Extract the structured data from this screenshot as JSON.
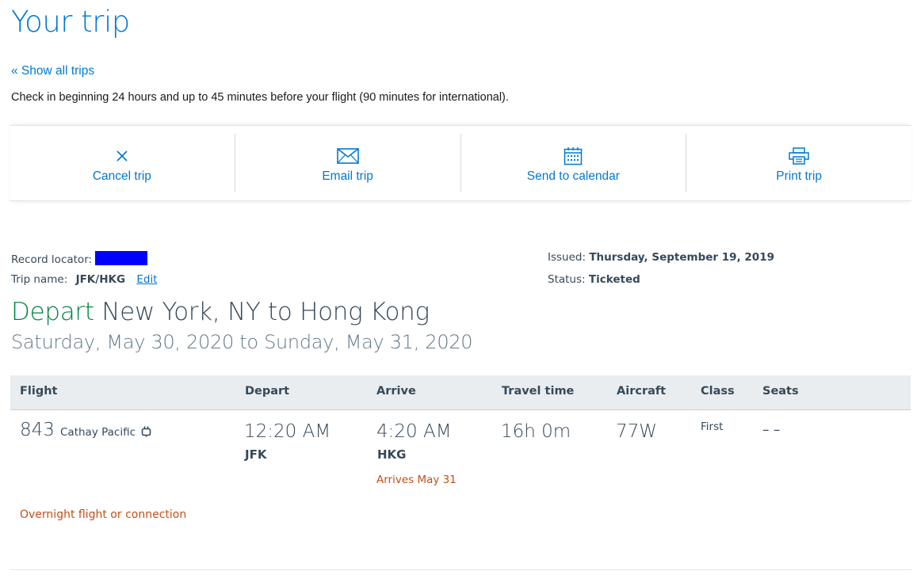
{
  "header": {
    "title": "Your trip",
    "show_all_trips": "« Show all trips",
    "checkin_note": "Check in beginning 24 hours and up to 45 minutes before your flight (90 minutes for international)."
  },
  "actions": [
    {
      "label": "Cancel trip",
      "icon": "close-icon"
    },
    {
      "label": "Email trip",
      "icon": "envelope-icon"
    },
    {
      "label": "Send to calendar",
      "icon": "calendar-icon"
    },
    {
      "label": "Print trip",
      "icon": "printer-icon"
    }
  ],
  "record": {
    "locator_label": "Record locator:",
    "trip_name_label": "Trip name:",
    "trip_name": "JFK/HKG",
    "edit_label": "Edit",
    "issued_label": "Issued:",
    "issued_value": "Thursday, September 19, 2019",
    "status_label": "Status:",
    "status_value": "Ticketed"
  },
  "itinerary": {
    "depart_word": "Depart",
    "route": "New York, NY to Hong Kong",
    "dates": "Saturday, May 30, 2020 to Sunday, May 31, 2020"
  },
  "table": {
    "columns": [
      "Flight",
      "Depart",
      "Arrive",
      "Travel time",
      "Aircraft",
      "Class",
      "Seats"
    ],
    "row": {
      "flight_number": "843",
      "airline": "Cathay Pacific",
      "depart_time": "12:20 AM",
      "depart_airport": "JFK",
      "arrive_time": "4:20 AM",
      "arrive_airport": "HKG",
      "arrive_note": "Arrives May 31",
      "travel_time": "16h 0m",
      "aircraft": "77W",
      "class": "First",
      "seats": "– –"
    },
    "overnight_note": "Overnight flight or connection"
  },
  "colors": {
    "link": "#0078d2",
    "depart_green": "#00853f",
    "warning": "#c3501b",
    "text": "#36495a",
    "redaction": "#0000ff"
  }
}
